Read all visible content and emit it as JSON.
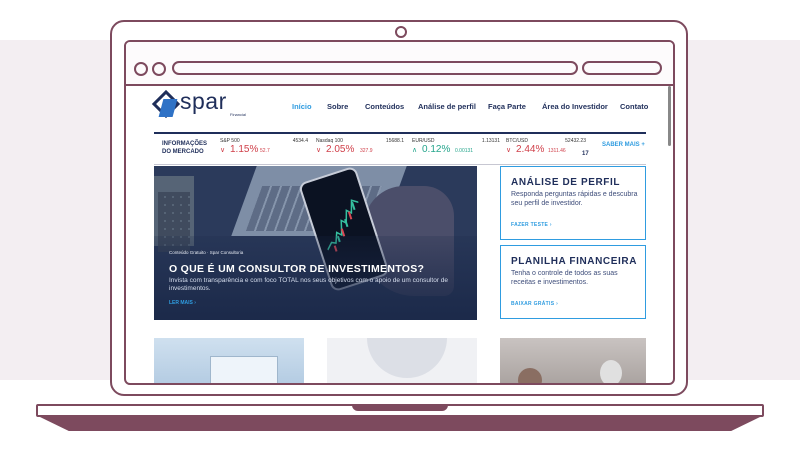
{
  "logo": {
    "text": "spar",
    "sub": "Financial"
  },
  "nav": [
    {
      "label": "Início",
      "active": true
    },
    {
      "label": "Sobre",
      "active": false
    },
    {
      "label": "Conteúdos",
      "active": false
    },
    {
      "label": "Análise de perfil",
      "active": false
    },
    {
      "label": "Faça Parte",
      "active": false
    },
    {
      "label": "Área do Investidor",
      "active": false
    },
    {
      "label": "Contato",
      "active": false
    }
  ],
  "ticker": {
    "title_line1": "INFORMAÇÕES",
    "title_line2": "DO MERCADO",
    "items": [
      {
        "name": "S&P 500",
        "price": "4534.4",
        "pct": "1.15%",
        "change": "52.7",
        "direction": "down",
        "arrow": "∨"
      },
      {
        "name": "Nasdaq 100",
        "price": "15688.1",
        "pct": "2.05%",
        "change": "327.9",
        "direction": "down",
        "arrow": "∨"
      },
      {
        "name": "EUR/USD",
        "price": "1.13131",
        "pct": "0.12%",
        "change": "0.00131",
        "direction": "up",
        "arrow": "∧"
      },
      {
        "name": "BTC/USD",
        "price": "52432.23",
        "pct": "2.44%",
        "change": "1311.46",
        "direction": "down",
        "arrow": "∨"
      }
    ],
    "saber_mais": "SABER MAIS",
    "tv_mark": "17"
  },
  "hero": {
    "tags": "Conteúdo Gratuito · Spar Consultoria",
    "title": "O QUE É UM CONSULTOR DE INVESTIMENTOS?",
    "body": "Invista com transparência e com foco TOTAL nos seus objetivos com o apoio de um consultor de investimentos.",
    "link": "LER MAIS"
  },
  "cards": [
    {
      "title": "ANÁLISE DE PERFIL",
      "body": "Responda perguntas rápidas e descubra seu perfil de investidor.",
      "link": "FAZER TESTE"
    },
    {
      "title": "PLANILHA FINANCEIRA",
      "body": "Tenha o controle de todos as suas receitas e investimentos.",
      "link": "BAIXAR GRÁTIS"
    }
  ],
  "colors": {
    "frame": "#7d4a5e",
    "navy": "#1f2e5a",
    "accent": "#2f9ce0",
    "negative": "#d0404a",
    "positive": "#25a58c"
  }
}
